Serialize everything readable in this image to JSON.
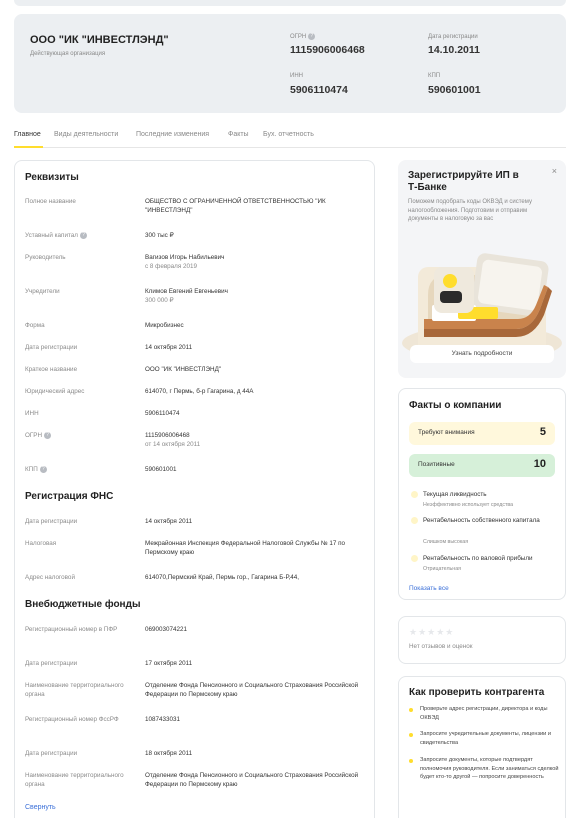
{
  "header": {
    "company_name": "ООО \"ИК \"ИНВЕСТЛЭНД\"",
    "status": "Действующая организация",
    "ogrn_label": "ОГРН",
    "ogrn_value": "1115906006468",
    "reg_date_label": "Дата регистрации",
    "reg_date_value": "14.10.2011",
    "inn_label": "ИНН",
    "inn_value": "5906110474",
    "kpp_label": "КПП",
    "kpp_value": "590601001"
  },
  "tabs": [
    "Главное",
    "Виды деятельности",
    "Последние изменения",
    "Факты",
    "Бух. отчетность"
  ],
  "requisites": {
    "title": "Реквизиты",
    "full_name_label": "Полное название",
    "full_name_value": "ОБЩЕСТВО С ОГРАНИЧЕННОЙ ОТВЕТСТВЕННОСТЬЮ \"ИК \"ИНВЕСТЛЭНД\"",
    "capital_label": "Уставный капитал",
    "capital_value": "300 тыс ₽",
    "head_label": "Руководитель",
    "head_value": "Вагизов Игорь Набильевич",
    "head_sub": "с 8 февраля 2019",
    "founders_label": "Учредители",
    "founders_value": "Климов Евгений Евгеньевич",
    "founders_sub": "300 000 ₽",
    "form_label": "Форма",
    "form_value": "Микробизнес",
    "reg_date_label": "Дата регистрации",
    "reg_date_value": "14 октября 2011",
    "short_name_label": "Краткое название",
    "short_name_value": "ООО \"ИК \"ИНВЕСТЛЭНД\"",
    "address_label": "Юридический адрес",
    "address_value": "614070, г Пермь, б-р Гагарина, д 44А",
    "inn_label": "ИНН",
    "inn_value": "5906110474",
    "ogrn_label": "ОГРН",
    "ogrn_value": "1115906006468",
    "ogrn_sub": "от 14 октября 2011",
    "kpp_label": "КПП",
    "kpp_value": "590601001"
  },
  "fns": {
    "title": "Регистрация ФНС",
    "reg_date_label": "Дата регистрации",
    "reg_date_value": "14 октября 2011",
    "tax_label": "Налоговая",
    "tax_value": "Межрайонная Инспекция Федеральной Налоговой Службы № 17 по Пермскому краю",
    "tax_addr_label": "Адрес налоговой",
    "tax_addr_value": "614070,Пермский Край, Пермь гор., Гагарина Б-Р,44,"
  },
  "funds": {
    "title": "Внебюджетные фонды",
    "pfr_num_label": "Регистрационный номер в ПФР",
    "pfr_num_value": "069003074221",
    "pfr_date_label": "Дата регистрации",
    "pfr_date_value": "17 октября 2011",
    "pfr_org_label": "Наименование территориального органа",
    "pfr_org_value": "Отделение Фонда Пенсионного и Социального Страхования Российской Федерации по Пермскому краю",
    "fss_num_label": "Регистрационный номер ФссРФ",
    "fss_num_value": "1087433031",
    "fss_date_label": "Дата регистрации",
    "fss_date_value": "18 октября 2011",
    "fss_org_label": "Наименование территориального органа",
    "fss_org_value": "Отделение Фонда Пенсионного и Социального Страхования Российской Федерации по Пермскому краю",
    "collapse_link": "Свернуть"
  },
  "promo": {
    "title": "Зарегистрируйте ИП в Т-Банке",
    "text": "Поможем подобрать коды ОКВЭД и систему налогообложения. Подготовим и отправим документы в налоговую за вас",
    "button": "Узнать подробности",
    "close": "×"
  },
  "facts": {
    "title": "Факты о компании",
    "attention_label": "Требуют внимания",
    "attention_count": "5",
    "positive_label": "Позитивные",
    "positive_count": "10",
    "items": [
      {
        "title": "Текущая ликвидность",
        "sub": "Неэффективно использует средства"
      },
      {
        "title": "Рентабельность собственного капитала",
        "sub": "Слишком высокая"
      },
      {
        "title": "Рентабельность по валовой прибыли",
        "sub": "Отрицательная"
      }
    ],
    "show_all": "Показать все"
  },
  "reviews": {
    "stars": "★★★★★",
    "text": "Нет отзывов и оценок"
  },
  "check": {
    "title": "Как проверить контрагента",
    "items": [
      "Проверьте адрес регистрации, директора и коды ОКВЭД",
      "Запросите учредительные документы, лицензии и свидетельства",
      "Запросите документы, которые подтвердят полномочия руководителя. Если заниматься сделкой будет кто-то другой — попросите доверенность"
    ]
  },
  "colors": {
    "accent": "#ffdd2d",
    "attention_bg": "#fff8dc",
    "positive_bg": "#d6f0d9",
    "link": "#3a6fd8"
  }
}
